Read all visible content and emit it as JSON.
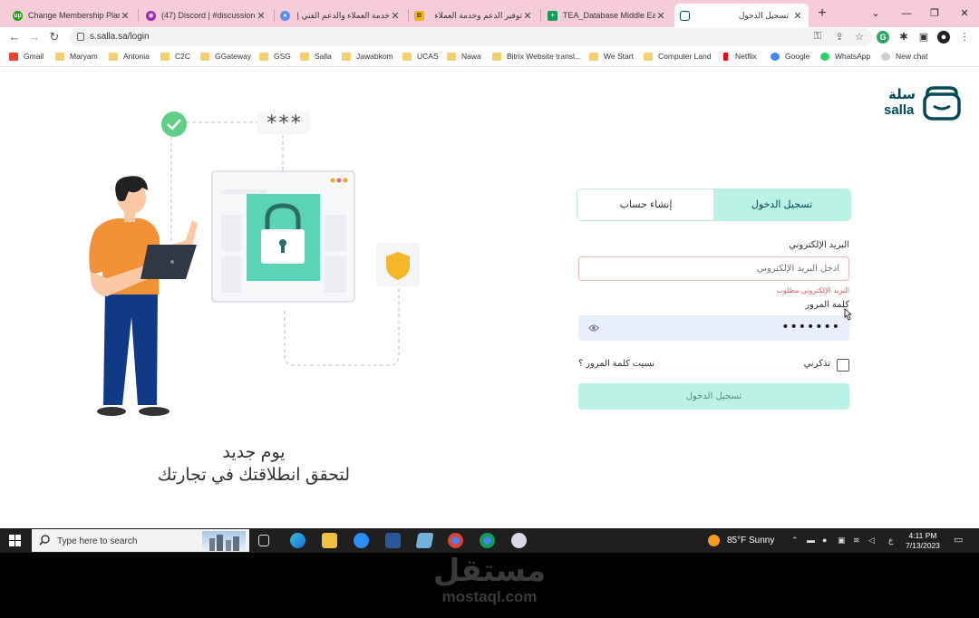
{
  "browser": {
    "tabs": [
      {
        "title": "Change Membership Plan",
        "icon": "upwork-icon",
        "color": "#14a800"
      },
      {
        "title": "(47) Discord | #discussion |",
        "icon": "discord-icon",
        "color": "#9c27b0"
      },
      {
        "title": "خدمة العملاء والدعم الفني |",
        "icon": "chrome-icon",
        "color": "#5b8def"
      },
      {
        "title": "توفير الدعم وخدمة العملاء",
        "icon": "b-icon",
        "color": "#f4b400"
      },
      {
        "title": "TEA_Database Middle East",
        "icon": "sheets-icon",
        "color": "#0f9d58"
      },
      {
        "title": "تسجيل الدخول",
        "icon": "salla-icon",
        "color": "#004956"
      }
    ],
    "url": "s.salla.sa/login",
    "bookmarks": [
      {
        "label": "Gmail",
        "type": "gmail"
      },
      {
        "label": "Maryam",
        "type": "folder"
      },
      {
        "label": "Antonia",
        "type": "folder"
      },
      {
        "label": "C2C",
        "type": "folder"
      },
      {
        "label": "GGateway",
        "type": "folder"
      },
      {
        "label": "GSG",
        "type": "folder"
      },
      {
        "label": "Salla",
        "type": "folder"
      },
      {
        "label": "Jawabkom",
        "type": "folder"
      },
      {
        "label": "UCAS",
        "type": "folder"
      },
      {
        "label": "Nawa",
        "type": "folder"
      },
      {
        "label": "Bitrix Website transl...",
        "type": "folder"
      },
      {
        "label": "We Start",
        "type": "folder"
      },
      {
        "label": "Computer Land",
        "type": "folder"
      },
      {
        "label": "Netflix",
        "type": "netflix"
      },
      {
        "label": "Google",
        "type": "google"
      },
      {
        "label": "WhatsApp",
        "type": "whatsapp"
      },
      {
        "label": "New chat",
        "type": "chatgpt"
      }
    ]
  },
  "page": {
    "logo_ar": "سلة",
    "logo_en": "salla",
    "tab_login": "تسجيل الدخول",
    "tab_register": "إنشاء حساب",
    "email_label": "البريد الإلكتروني",
    "email_placeholder": "أدخل البريد الإلكتروني",
    "email_error": "البريد الإلكتروني مطلوب",
    "password_label": "كلمة المرور",
    "password_value": "•••••••",
    "remember_label": "تذكرني",
    "forgot_label": "نسيت كلمة المرور ؟",
    "login_button": "تسجيل الدخول",
    "tagline_line1": "يوم جديد",
    "tagline_line2": "لتحقق انطلاقتك في تجارتك",
    "illustration_stars": "***"
  },
  "taskbar": {
    "search_placeholder": "Type here to search",
    "weather": "85°F  Sunny",
    "input_lang": "ع",
    "time": "4:11 PM",
    "date": "7/13/2023"
  },
  "watermark": {
    "ar": "مستقل",
    "en": "mostaql.com"
  },
  "colors": {
    "accent": "#baf3e6",
    "brand": "#004956",
    "error": "#e05a5a",
    "tabstrip": "#f6ccd9"
  }
}
